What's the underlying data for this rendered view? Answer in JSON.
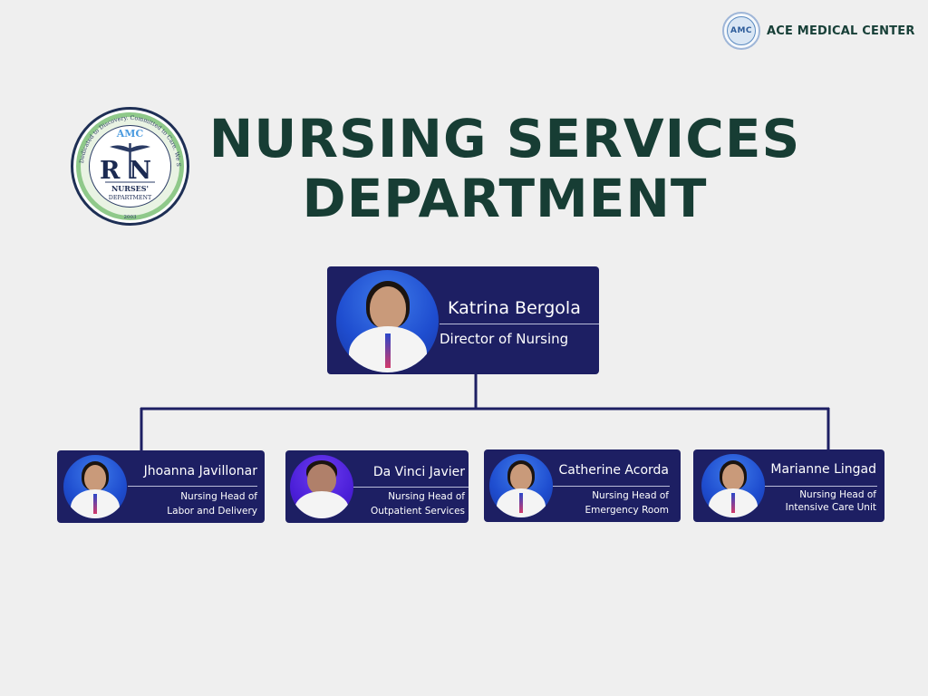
{
  "brand": {
    "name": "ACE MEDICAL CENTER",
    "logo_text": "AMC"
  },
  "seal": {
    "top_text": "AMC",
    "monogram": "RN",
    "line1": "NURSES'",
    "line2": "DEPARTMENT",
    "year": "2003",
    "motto": "Dedicated to Discovery. Committed to Care. We Strive for the Best."
  },
  "title": {
    "line1": "NURSING SERVICES",
    "line2": "DEPARTMENT"
  },
  "director": {
    "name": "Katrina Bergola",
    "role": "Director of Nursing"
  },
  "heads": [
    {
      "name": "Jhoanna Javillonar",
      "role_line1": "Nursing Head of",
      "role_line2": "Labor and Delivery"
    },
    {
      "name": "Da Vinci Javier",
      "role_line1": "Nursing Head of",
      "role_line2": "Outpatient Services"
    },
    {
      "name": "Catherine Acorda",
      "role_line1": "Nursing Head of",
      "role_line2": "Emergency Room"
    },
    {
      "name": "Marianne Lingad",
      "role_line1": "Nursing Head of",
      "role_line2": "Intensive Care Unit"
    }
  ],
  "colors": {
    "background": "#efefef",
    "card": "#1d1f63",
    "title": "#173d34",
    "connector": "#1d1f63",
    "photo_background": "#2a5fe0"
  }
}
